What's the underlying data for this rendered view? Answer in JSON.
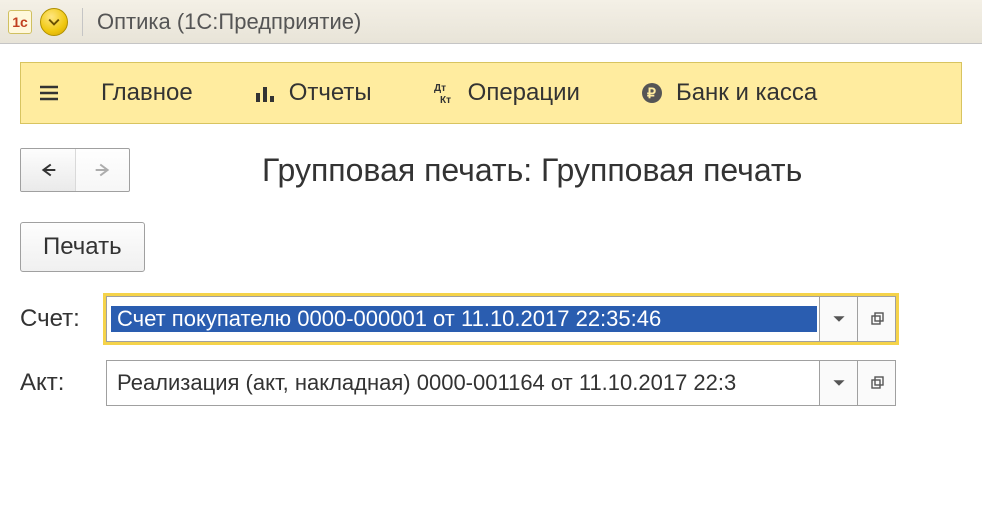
{
  "titlebar": {
    "app_icon_text": "1c",
    "title": "Оптика  (1С:Предприятие)"
  },
  "toolbar": {
    "home": "Главное",
    "reports": "Отчеты",
    "operations": "Операции",
    "bank": "Банк и касса"
  },
  "page": {
    "title": "Групповая печать: Групповая печать",
    "print_label": "Печать"
  },
  "fields": {
    "invoice": {
      "label": "Счет:",
      "value": "Счет покупателю 0000-000001 от 11.10.2017 22:35:46"
    },
    "act": {
      "label": "Акт:",
      "value": "Реализация (акт, накладная) 0000-001164 от 11.10.2017 22:3"
    }
  }
}
